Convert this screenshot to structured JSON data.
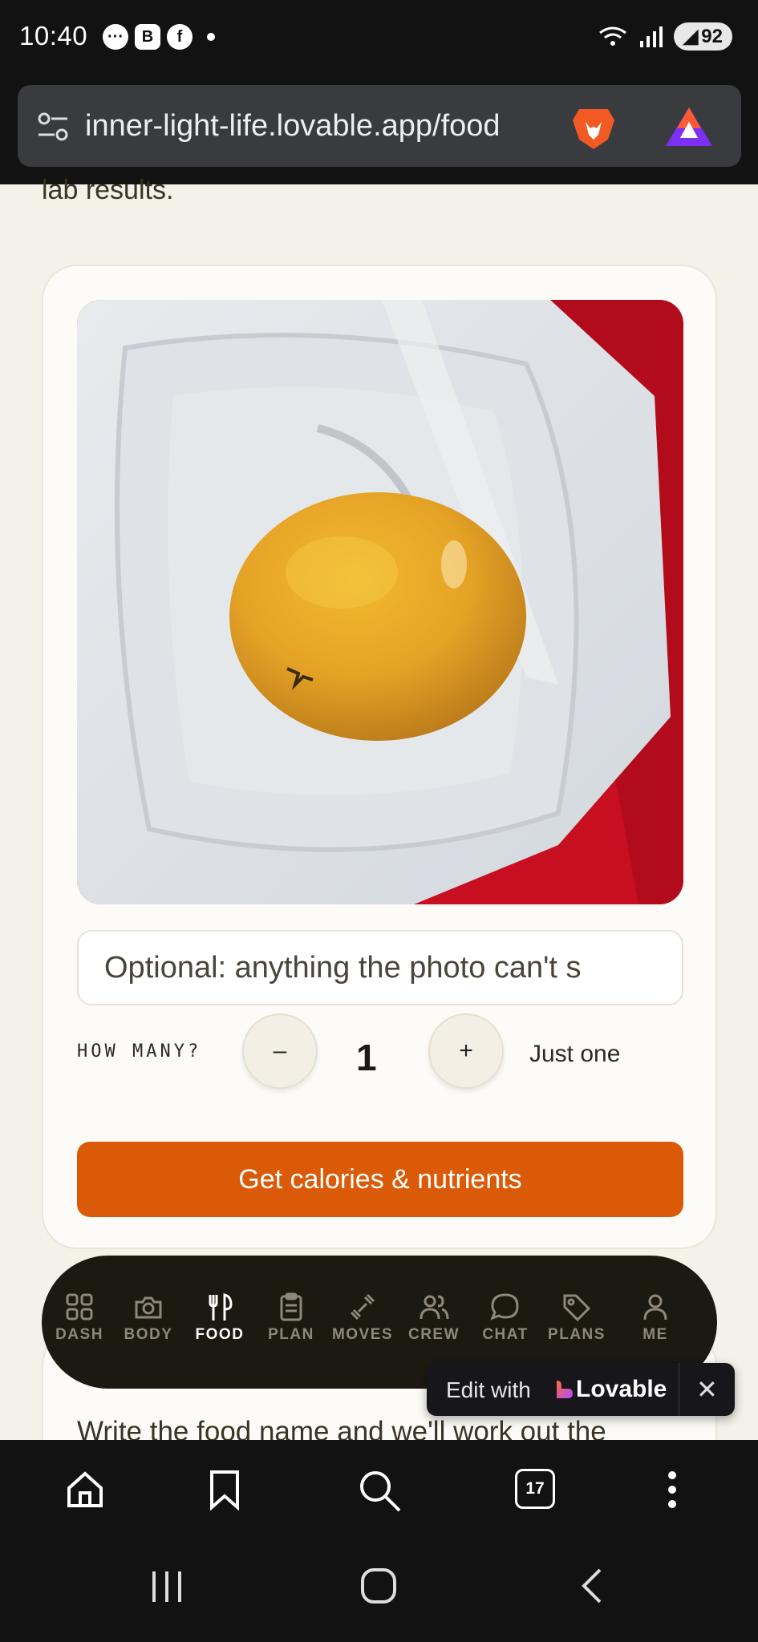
{
  "status_bar": {
    "time": "10:40",
    "app_b_label": "B",
    "app_f_label": "f",
    "battery": "92"
  },
  "browser": {
    "url": "inner-light-life.lovable.app/food",
    "tab_count": "17"
  },
  "content": {
    "previous_text": "lab results.",
    "photo_subject": "apple",
    "note_placeholder": "Optional: anything the photo can't s",
    "how_many_label": "HOW MANY?",
    "minus_label": "–",
    "quantity": "1",
    "plus_label": "+",
    "quantity_hint": "Just one",
    "cta_label": "Get calories & nutrients",
    "next_card_text": "Write the food name and we'll work out the"
  },
  "nav": {
    "items": [
      {
        "label": "DASH",
        "icon": "grid-icon",
        "active": false
      },
      {
        "label": "BODY",
        "icon": "camera-icon",
        "active": false
      },
      {
        "label": "FOOD",
        "icon": "utensils-icon",
        "active": true
      },
      {
        "label": "PLAN",
        "icon": "clipboard-icon",
        "active": false
      },
      {
        "label": "MOVES",
        "icon": "dumbbell-icon",
        "active": false
      },
      {
        "label": "CREW",
        "icon": "users-icon",
        "active": false
      },
      {
        "label": "CHAT",
        "icon": "chat-icon",
        "active": false
      },
      {
        "label": "PLANS",
        "icon": "tag-icon",
        "active": false
      },
      {
        "label": "ME",
        "icon": "user-icon",
        "active": false
      }
    ]
  },
  "lovable_badge": {
    "edit_text": "Edit with",
    "brand": "Lovable",
    "close": "✕"
  },
  "colors": {
    "accent": "#da5a07",
    "background": "#f4f1e8",
    "nav_bg": "#1c1911"
  }
}
